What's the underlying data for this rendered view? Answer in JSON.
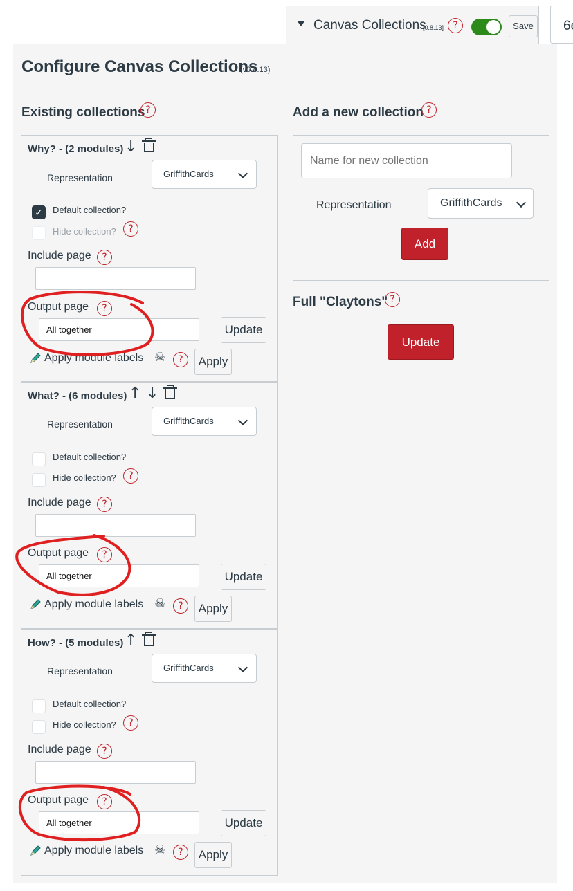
{
  "toolbar": {
    "title": "Canvas Collections",
    "version": "[0.8.13]",
    "save_label": "Save",
    "cut_button_text": "6e",
    "toggle_on": true
  },
  "configure": {
    "title": "Configure Canvas Collections",
    "version": "(v0.8.13)"
  },
  "existing": {
    "heading": "Existing collections",
    "collections": [
      {
        "title": "Why? - (2 modules)",
        "representation_label": "Representation",
        "representation_value": "GriffithCards",
        "default_label": "Default collection?",
        "default_checked": true,
        "hide_label": "Hide collection?",
        "hide_disabled": true,
        "include_label": "Include page",
        "include_value": "",
        "output_label": "Output page",
        "output_value": "All together",
        "update_label": "Update",
        "apply_label": "Apply module labels",
        "apply_button": "Apply"
      },
      {
        "title": "What? - (6 modules)",
        "representation_label": "Representation",
        "representation_value": "GriffithCards",
        "default_label": "Default collection?",
        "default_checked": false,
        "hide_label": "Hide collection?",
        "hide_disabled": false,
        "include_label": "Include page",
        "include_value": "",
        "output_label": "Output page",
        "output_value": "All together",
        "update_label": "Update",
        "apply_label": "Apply module labels",
        "apply_button": "Apply"
      },
      {
        "title": "How? - (5 modules)",
        "representation_label": "Representation",
        "representation_value": "GriffithCards",
        "default_label": "Default collection?",
        "default_checked": false,
        "hide_label": "Hide collection?",
        "hide_disabled": false,
        "include_label": "Include page",
        "include_value": "",
        "output_label": "Output page",
        "output_value": "All together",
        "update_label": "Update",
        "apply_label": "Apply module labels",
        "apply_button": "Apply"
      }
    ]
  },
  "add_new": {
    "heading": "Add a new collection",
    "name_placeholder": "Name for new collection",
    "representation_label": "Representation",
    "representation_value": "GriffithCards",
    "add_label": "Add"
  },
  "claytons": {
    "heading": "Full \"Claytons\"",
    "update_label": "Update"
  },
  "colors": {
    "accent_red": "#c0212a",
    "toggle_green": "#2b8a1a",
    "text": "#2d3b45",
    "annotation_red": "#e02020"
  }
}
